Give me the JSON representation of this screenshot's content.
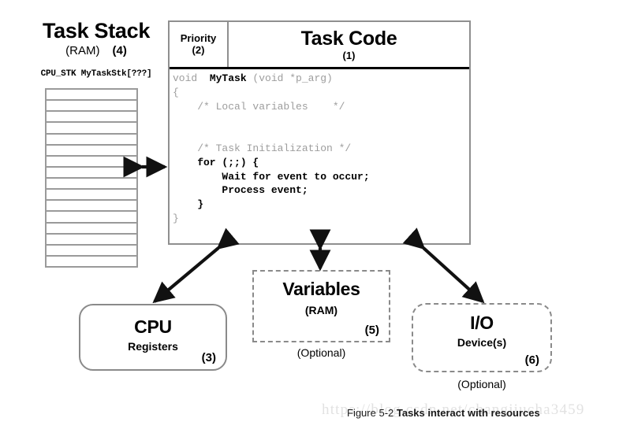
{
  "figure": {
    "caption_prefix": "Figure 5-2",
    "caption_title": "Tasks interact with resources",
    "watermark": "https://blog.csdn.net/changjiucha3459"
  },
  "task_stack": {
    "title": "Task Stack",
    "memory": "(RAM)",
    "number": "(4)",
    "declaration": "CPU_STK MyTaskStk[???]",
    "cell_count": 16
  },
  "code_table": {
    "priority": {
      "label": "Priority",
      "number": "(2)"
    },
    "task_code": {
      "label": "Task Code",
      "number": "(1)"
    },
    "code_lines": [
      {
        "text": "void  ",
        "bold": false
      },
      {
        "text": "MyTask",
        "bold": true
      },
      {
        "text": " (void *p_arg)",
        "bold": false
      },
      {
        "text": "{",
        "bold": false
      },
      {
        "text": "    /* Local variables    */",
        "bold": false
      },
      {
        "text": "",
        "bold": false
      },
      {
        "text": "",
        "bold": false
      },
      {
        "text": "    /* Task Initialization */",
        "bold": false
      },
      {
        "text": "    for (;;) {",
        "bold": true
      },
      {
        "text": "        Wait for event to occur;",
        "bold": true
      },
      {
        "text": "        Process event;",
        "bold": true
      },
      {
        "text": "    }",
        "bold": true
      },
      {
        "text": "}",
        "bold": false
      }
    ],
    "code_text_line1_plain_a": "void  ",
    "code_text_line1_bold": "MyTask",
    "code_text_line1_plain_b": " (void *p_arg)",
    "code_text_line2": "{",
    "code_text_line3": "    /* Local variables    */",
    "code_text_line4": "    /* Task Initialization */",
    "code_text_line5": "    for (;;) {",
    "code_text_line6": "        Wait for event to occur;",
    "code_text_line7": "        Process event;",
    "code_text_line8": "    }",
    "code_text_line9": "}"
  },
  "resources": {
    "cpu": {
      "title": "CPU",
      "subtitle": "Registers",
      "number": "(3)"
    },
    "variables": {
      "title": "Variables",
      "subtitle": "(RAM)",
      "number": "(5)",
      "optional": "(Optional)"
    },
    "io": {
      "title": "I/O",
      "subtitle": "Device(s)",
      "number": "(6)",
      "optional": "(Optional)"
    }
  },
  "colors": {
    "border_gray": "#8a8a8a",
    "code_gray": "#9d9d9d",
    "arrow_black": "#111111",
    "watermark_gray": "#e2e2e2"
  }
}
